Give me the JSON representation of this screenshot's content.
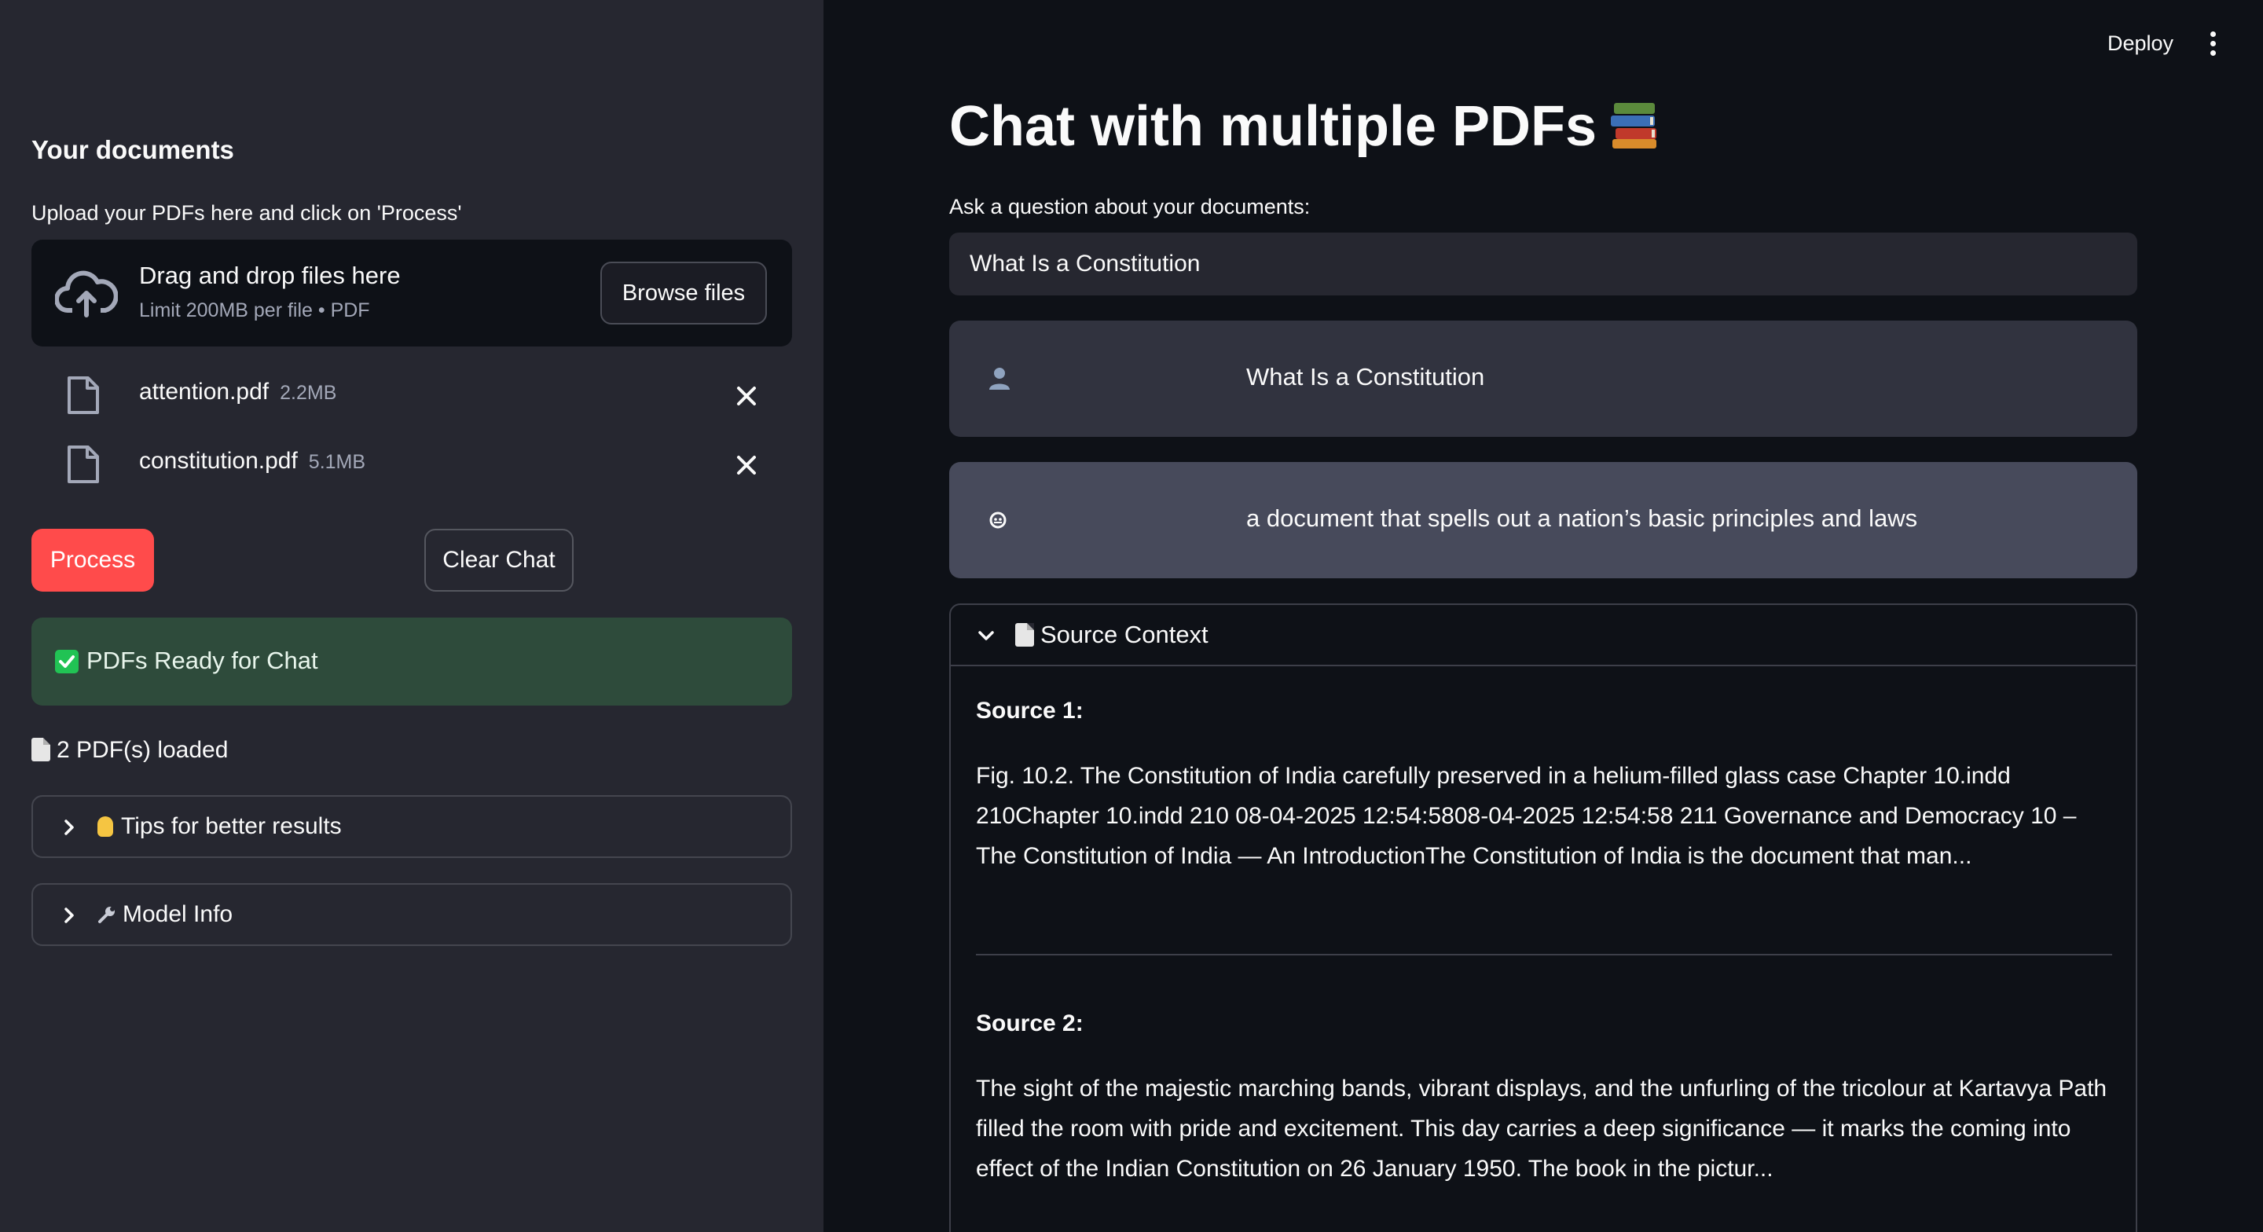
{
  "sidebar": {
    "title": "Your documents",
    "upload_label": "Upload your PDFs here and click on 'Process'",
    "dropzone": {
      "main_text": "Drag and drop files here",
      "sub_text": "Limit 200MB per file • PDF",
      "browse_label": "Browse files"
    },
    "files": [
      {
        "name": "attention.pdf",
        "size": "2.2MB"
      },
      {
        "name": "constitution.pdf",
        "size": "5.1MB"
      }
    ],
    "process_label": "Process",
    "clear_label": "Clear Chat",
    "status_text": "PDFs Ready for Chat",
    "loaded_text": "2 PDF(s) loaded",
    "expanders": [
      {
        "label": "Tips for better results",
        "icon": "lightbulb-icon"
      },
      {
        "label": "Model Info",
        "icon": "wrench-icon"
      }
    ]
  },
  "header": {
    "deploy_label": "Deploy",
    "menu_icon": "kebab-menu-icon"
  },
  "main": {
    "title": "Chat with multiple PDFs",
    "title_icon": "books-icon",
    "question_label": "Ask a question about your documents:",
    "question_value": "What Is a Constitution",
    "messages": [
      {
        "role": "user",
        "avatar": "user-avatar-icon",
        "text": "What Is a Constitution"
      },
      {
        "role": "assistant",
        "avatar": "bot-avatar-icon",
        "text": "a document that spells out a nation’s basic principles and laws"
      }
    ],
    "source_context": {
      "label": "Source Context",
      "sources": [
        {
          "title": "Source 1:",
          "text": "Fig. 10.2. The Constitution of India carefully preserved in a helium-filled glass case Chapter 10.indd 210Chapter 10.indd 210 08-04-2025 12:54:5808-04-2025 12:54:58 211 Governance and Democracy 10 – The Constitution of India — An IntroductionThe Constitution of India is the document that man..."
        },
        {
          "title": "Source 2:",
          "text": "The sight of the majestic marching bands, vibrant displays, and the unfurling of the tricolour at Kartavya Path filled the room with pride and excitement. This day carries a deep significance — it marks the coming into effect of the Indian Constitution on 26 January 1950. The book in the pictur..."
        }
      ]
    }
  },
  "colors": {
    "main_bg": "#0e1117",
    "sidebar_bg": "#262730",
    "accent": "#ff4b4b",
    "success_bg": "#2e4b3b"
  }
}
